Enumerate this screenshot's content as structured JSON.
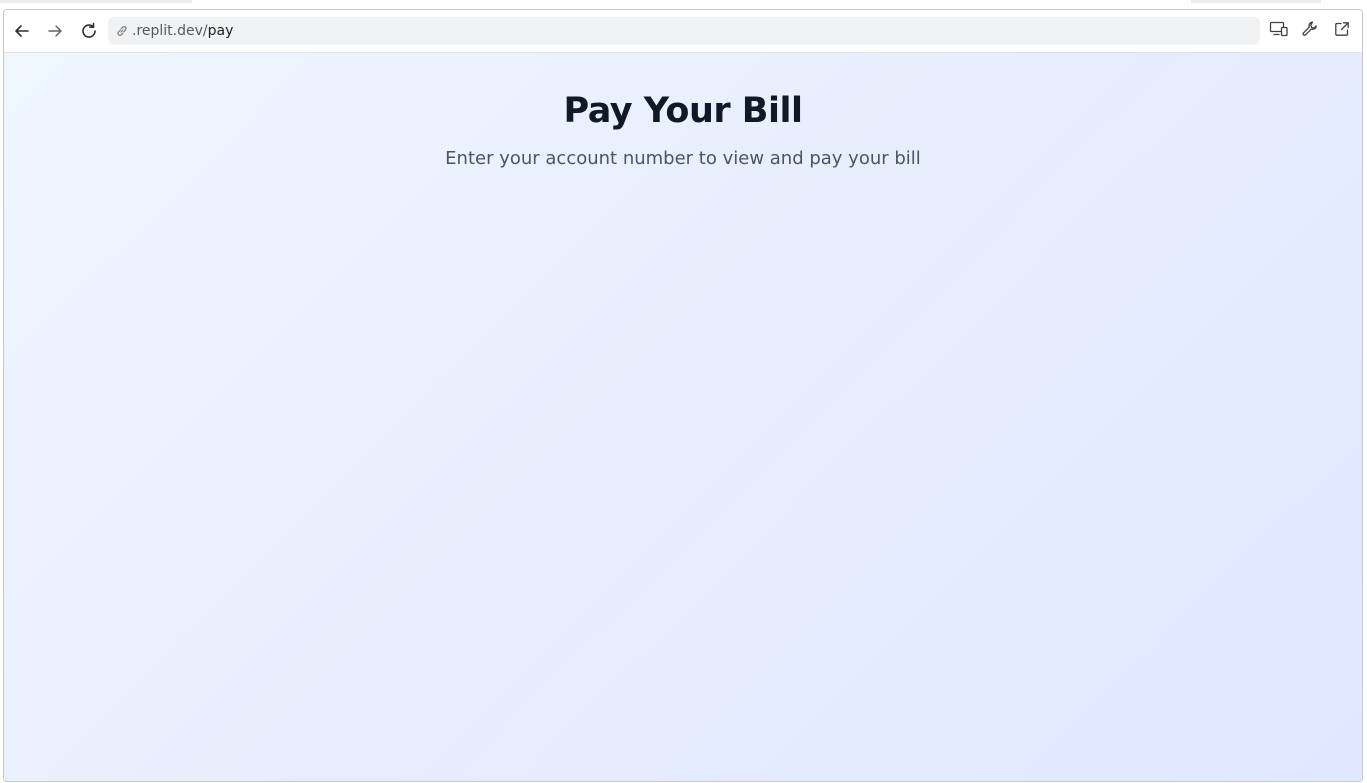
{
  "browser": {
    "url_host": ".replit.dev/",
    "url_path": "pay",
    "icons": {
      "back": "arrow-left-icon",
      "forward": "arrow-right-icon",
      "reload": "reload-icon",
      "link": "link-icon",
      "devices": "devices-icon",
      "tools": "wrench-icon",
      "open_new": "external-link-icon"
    }
  },
  "page": {
    "title": "Pay Your Bill",
    "subtitle": "Enter your account number to view and pay your bill"
  },
  "colors": {
    "background_start": "#eff6ff",
    "background_end": "#e0e7ff",
    "title": "#111827",
    "subtitle": "#4b5563"
  }
}
